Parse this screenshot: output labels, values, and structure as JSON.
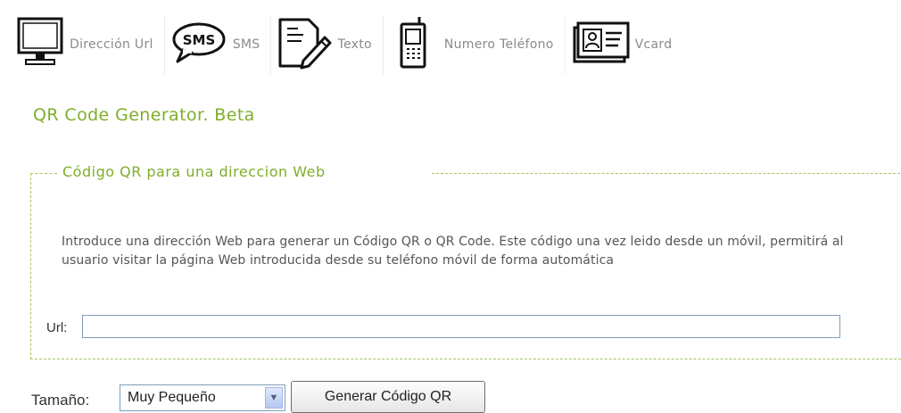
{
  "tabs": [
    {
      "label": "Dirección Url",
      "icon": "monitor-icon"
    },
    {
      "label": "SMS",
      "icon": "sms-bubble-icon",
      "badge": "SMS"
    },
    {
      "label": "Texto",
      "icon": "document-edit-icon"
    },
    {
      "label": "Numero Teléfono",
      "icon": "mobile-phone-icon"
    },
    {
      "label": "Vcard",
      "icon": "contact-card-icon"
    }
  ],
  "title": "QR Code Generator. Beta",
  "section": {
    "legend": "Código QR para una direccion Web",
    "description": "Introduce una dirección Web para generar un Código QR o QR Code. Este código una vez leido desde un móvil, permitirá al usuario visitar la página Web introducida desde su teléfono móvil de forma automática",
    "url_label": "Url:",
    "url_value": ""
  },
  "controls": {
    "size_label": "Tamaño:",
    "size_value": "Muy Pequeño",
    "generate_label": "Generar Código QR"
  },
  "colors": {
    "accent": "#7fae2c",
    "tab_text": "#8a8a8a",
    "fieldset_border": "#9fc75a"
  }
}
